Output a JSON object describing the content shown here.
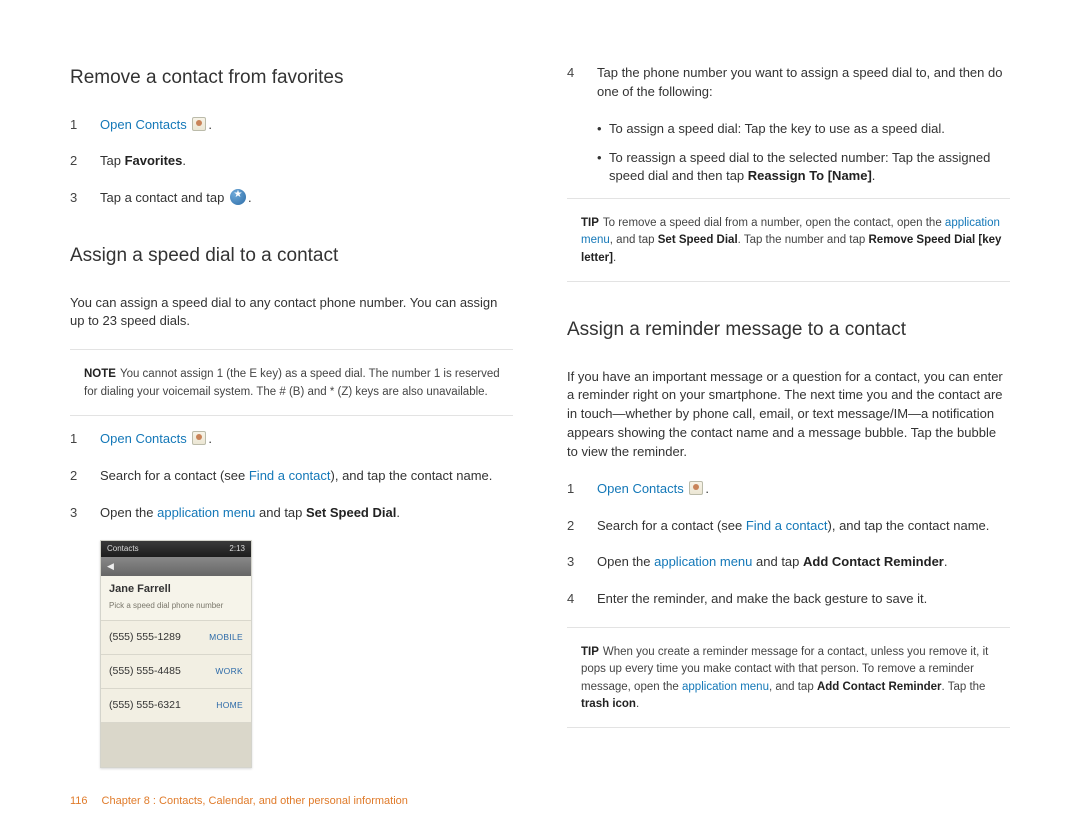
{
  "left": {
    "h_remove": "Remove a contact from favorites",
    "steps_remove": [
      {
        "n": "1",
        "prefix": "Open",
        "bold": "Contacts",
        "suffix": "",
        "icon": "contacts",
        "link": true,
        "trail": "."
      },
      {
        "n": "2",
        "prefix": "Tap ",
        "bold": "Favorites",
        "suffix": ".",
        "icon": null,
        "link": false
      },
      {
        "n": "3",
        "prefix": "Tap a contact and tap ",
        "bold": "",
        "suffix": ".",
        "icon": "star",
        "link": false
      }
    ],
    "h_speed": "Assign a speed dial to a contact",
    "intro_speed": "You can assign a speed dial to any contact phone number. You can assign up to 23 speed dials.",
    "note_label": "NOTE",
    "note_speed": "You cannot assign 1 (the E key) as a speed dial. The number 1 is reserved for dialing your voicemail system. The # (B) and * (Z) keys are also unavailable.",
    "steps_speed": [
      {
        "n": "1",
        "html": [
          {
            "t": "Open",
            "link": true
          },
          {
            "t": " "
          },
          {
            "t": "Contacts",
            "bold": true,
            "link": true
          },
          {
            "icon": "contacts"
          },
          {
            "t": "."
          }
        ]
      },
      {
        "n": "2",
        "html": [
          {
            "t": "Search for a contact (see "
          },
          {
            "t": "Find a contact",
            "link": true
          },
          {
            "t": "), and tap the contact name."
          }
        ]
      },
      {
        "n": "3",
        "html": [
          {
            "t": "Open the "
          },
          {
            "t": "application menu",
            "link": true
          },
          {
            "t": " and tap "
          },
          {
            "t": "Set Speed Dial",
            "bold": true
          },
          {
            "t": "."
          }
        ]
      }
    ],
    "shot": {
      "topLeft": "Contacts",
      "topRight": "2:13",
      "name": "Jane Farrell",
      "hint": "Pick a speed dial phone number",
      "rows": [
        {
          "num": "(555) 555-1289",
          "tag": "MOBILE"
        },
        {
          "num": "(555) 555-4485",
          "tag": "WORK"
        },
        {
          "num": "(555) 555-6321",
          "tag": "HOME"
        }
      ]
    }
  },
  "right": {
    "step4": {
      "n": "4",
      "text": "Tap the phone number you want to assign a speed dial to, and then do one of the following:"
    },
    "bullets": [
      [
        {
          "t": "To assign a speed dial: Tap the key to use as a speed dial."
        }
      ],
      [
        {
          "t": "To reassign a speed dial to the selected number: Tap the assigned speed dial and then tap "
        },
        {
          "t": "Reassign To [Name]",
          "bold": true
        },
        {
          "t": "."
        }
      ]
    ],
    "tip1_label": "TIP",
    "tip1": [
      {
        "t": "To remove a speed dial from a number, open the contact, open the "
      },
      {
        "t": "application menu",
        "link": true
      },
      {
        "t": ", and tap "
      },
      {
        "t": "Set Speed Dial",
        "bold": true
      },
      {
        "t": ". Tap the number and tap "
      },
      {
        "t": "Remove Speed Dial [key letter]",
        "bold": true
      },
      {
        "t": "."
      }
    ],
    "h_reminder": "Assign a reminder message to a contact",
    "intro_reminder": "If you have an important message or a question for a contact, you can enter a reminder right on your smartphone. The next time you and the contact are in touch—whether by phone call, email, or text message/IM—a notification appears showing the contact name and a message bubble. Tap the bubble to view the reminder.",
    "steps_reminder": [
      {
        "n": "1",
        "html": [
          {
            "t": "Open",
            "link": true
          },
          {
            "t": " "
          },
          {
            "t": "Contacts",
            "bold": true,
            "link": true
          },
          {
            "icon": "contacts"
          },
          {
            "t": "."
          }
        ]
      },
      {
        "n": "2",
        "html": [
          {
            "t": "Search for a contact (see "
          },
          {
            "t": "Find a contact",
            "link": true
          },
          {
            "t": "), and tap the contact name."
          }
        ]
      },
      {
        "n": "3",
        "html": [
          {
            "t": "Open the "
          },
          {
            "t": "application menu",
            "link": true
          },
          {
            "t": " and tap "
          },
          {
            "t": "Add Contact Reminder",
            "bold": true
          },
          {
            "t": "."
          }
        ]
      },
      {
        "n": "4",
        "html": [
          {
            "t": "Enter the reminder, and make the back gesture to save it."
          }
        ]
      }
    ],
    "tip2_label": "TIP",
    "tip2": [
      {
        "t": "When you create a reminder message for a contact, unless you remove it, it pops up every time you make contact with that person. To remove a reminder message, open the "
      },
      {
        "t": "application menu",
        "link": true
      },
      {
        "t": ", and tap "
      },
      {
        "t": "Add Contact Reminder",
        "bold": true
      },
      {
        "t": ". Tap the "
      },
      {
        "t": "trash icon",
        "bold": true
      },
      {
        "t": "."
      }
    ]
  },
  "footer": {
    "page": "116",
    "text": "Chapter 8 : Contacts, Calendar, and other personal information"
  }
}
